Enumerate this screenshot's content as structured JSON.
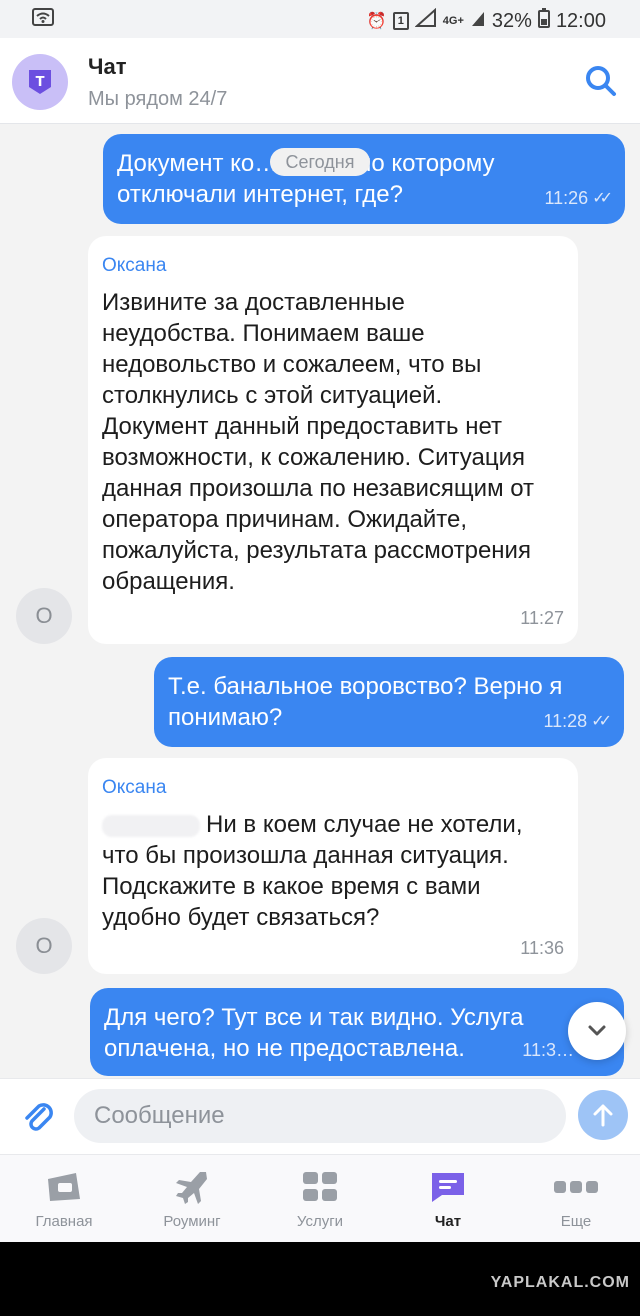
{
  "status_bar": {
    "battery": "32%",
    "time": "12:00",
    "network": "4G+",
    "sim": "1"
  },
  "header": {
    "title": "Чат",
    "subtitle": "Мы рядом 24/7"
  },
  "date_separator": "Сегодня",
  "messages": [
    {
      "direction": "out",
      "text": "Документ ко… согласно которому отключали интернет, где?",
      "time": "11:26",
      "read": true
    },
    {
      "direction": "in",
      "sender": "Оксана",
      "avatar": "О",
      "text": "Извините за доставленные неудобства. Понимаем ваше недовольство и сожалеем, что вы столкнулись с этой ситуацией. Документ данный предоставить нет возможности, к сожалению. Ситуация данная произошла по независящим от оператора причинам. Ожидайте, пожалуйста, результата рассмотрения обращения.",
      "time": "11:27"
    },
    {
      "direction": "out",
      "text": "Т.е. банальное воровство? Верно я понимаю?",
      "time": "11:28",
      "read": true
    },
    {
      "direction": "in",
      "sender": "Оксана",
      "avatar": "О",
      "text": "Ни в коем случае не хотели, что бы произошла данная ситуация. Подскажите в какое время с вами удобно будет связаться?",
      "time": "11:36"
    },
    {
      "direction": "out",
      "text": "Для чего? Тут все и так видно. Услуга оплачена, но не предоставлена.",
      "time": "11:3…"
    }
  ],
  "composer": {
    "placeholder": "Сообщение"
  },
  "tabs": [
    {
      "label": "Главная",
      "icon": "home-card-icon"
    },
    {
      "label": "Роуминг",
      "icon": "airplane-icon"
    },
    {
      "label": "Услуги",
      "icon": "grid-icon"
    },
    {
      "label": "Чат",
      "icon": "chat-icon",
      "active": true
    },
    {
      "label": "Еще",
      "icon": "more-icon"
    }
  ],
  "watermark": "YAPLAKAL.COM",
  "colors": {
    "accent": "#3a86f1",
    "brand": "#7b61e8",
    "chat_bg": "#f3f3f3"
  }
}
